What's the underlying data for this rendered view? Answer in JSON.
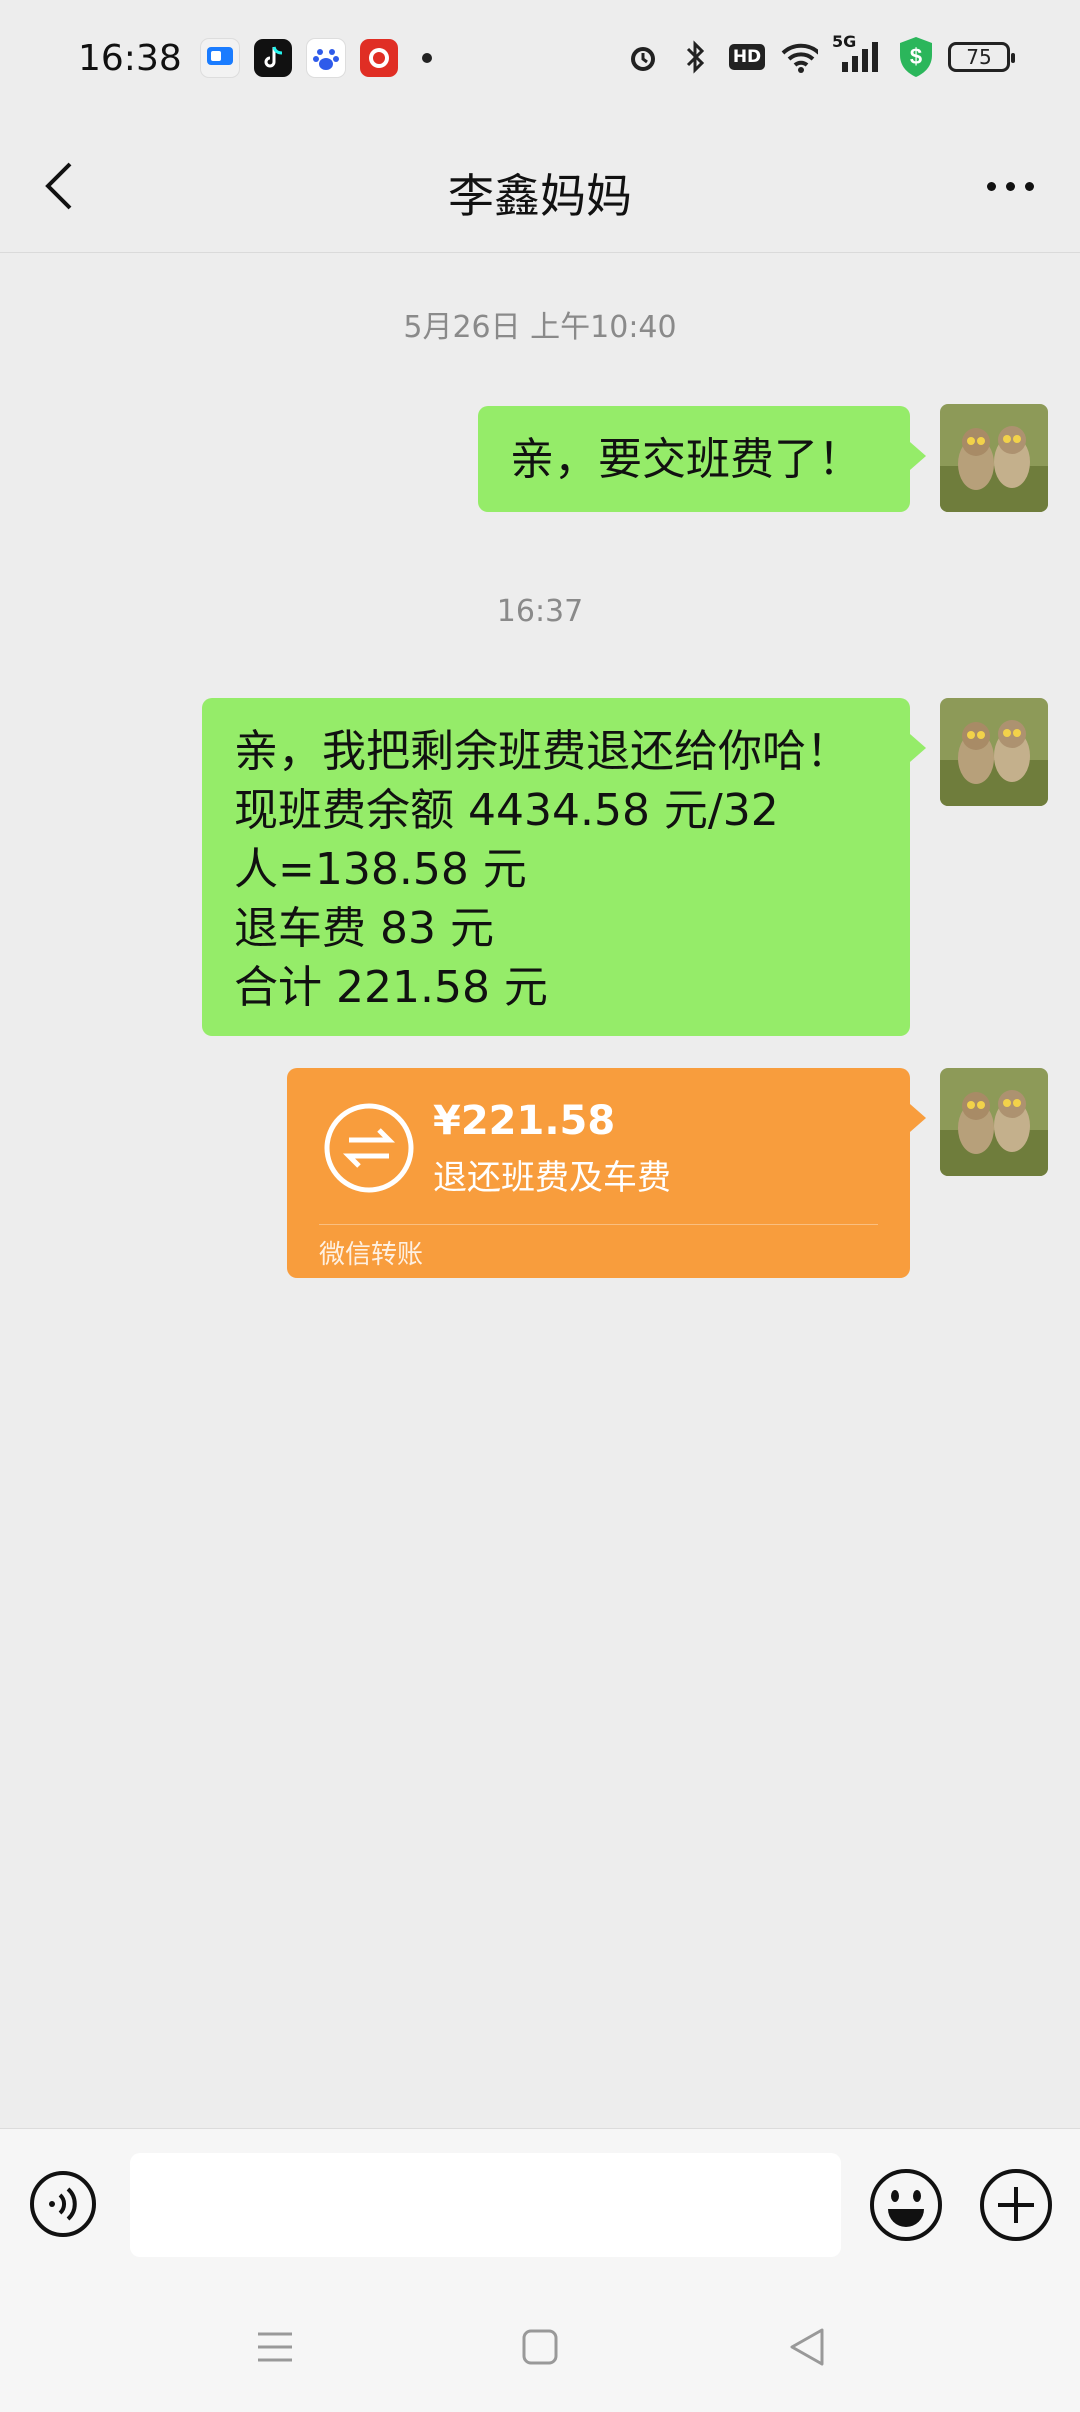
{
  "status_bar": {
    "time": "16:38",
    "app_icons": [
      "messenger-app-icon",
      "tiktok-app-icon",
      "baidu-app-icon",
      "pinduoduo-app-icon"
    ],
    "right_icons": [
      "alarm-icon",
      "bluetooth-icon",
      "hd-icon",
      "wifi-icon",
      "5g-signal-icon",
      "security-shield-icon"
    ],
    "hd_label": "HD",
    "network_label": "5G",
    "battery": "75"
  },
  "header": {
    "title": "李鑫妈妈"
  },
  "chat": {
    "timestamp_1": "5月26日 上午10:40",
    "message_1": "亲，要交班费了！",
    "timestamp_2": "16:37",
    "message_2_lines": [
      "亲，我把剩余班费退还给你哈！",
      "现班费余额 4434.58 元/32",
      "人=138.58 元",
      "退车费 83 元",
      "合计 221.58 元"
    ],
    "transfer": {
      "amount": "¥221.58",
      "memo": "退还班费及车费",
      "label": "微信转账"
    }
  },
  "input_bar": {
    "placeholder": ""
  },
  "colors": {
    "background": "#ededed",
    "sent_bubble": "#95ec69",
    "transfer_card": "#f89d3d",
    "input_bar": "#f6f6f6"
  }
}
